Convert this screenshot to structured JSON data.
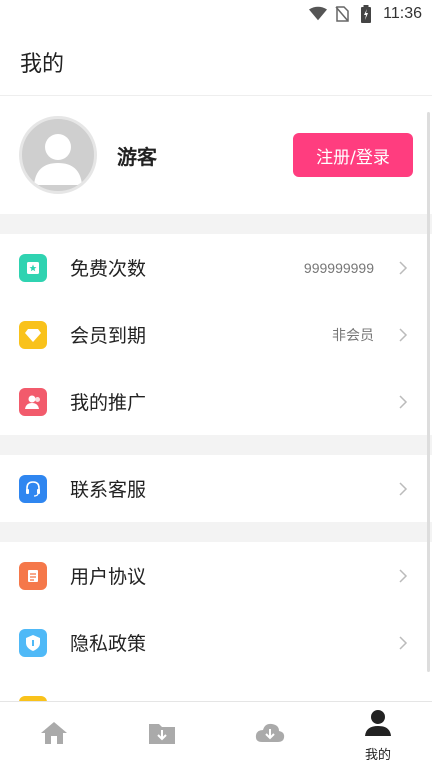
{
  "status": {
    "time": "11:36",
    "icons": [
      "wifi-icon",
      "no-sim-icon",
      "battery-icon"
    ]
  },
  "header": {
    "title": "我的"
  },
  "profile": {
    "username": "游客",
    "login_label": "注册/登录"
  },
  "groups": [
    [
      {
        "icon": "ticket-icon",
        "color": "#2fd3b1",
        "label": "免费次数",
        "value": "999999999"
      },
      {
        "icon": "diamond-icon",
        "color": "#f9c21b",
        "label": "会员到期",
        "value": "非会员"
      },
      {
        "icon": "share-users-icon",
        "color": "#f25b6c",
        "label": "我的推广",
        "value": ""
      }
    ],
    [
      {
        "icon": "headset-icon",
        "color": "#2f86f0",
        "label": "联系客服",
        "value": ""
      }
    ],
    [
      {
        "icon": "document-icon",
        "color": "#f5784a",
        "label": "用户协议",
        "value": ""
      },
      {
        "icon": "shield-icon",
        "color": "#4fb9f7",
        "label": "隐私政策",
        "value": ""
      }
    ]
  ],
  "tabbar": [
    {
      "icon": "home-icon",
      "label": ""
    },
    {
      "icon": "folder-download-icon",
      "label": ""
    },
    {
      "icon": "cloud-download-icon",
      "label": ""
    },
    {
      "icon": "person-icon",
      "label": "我的"
    }
  ]
}
